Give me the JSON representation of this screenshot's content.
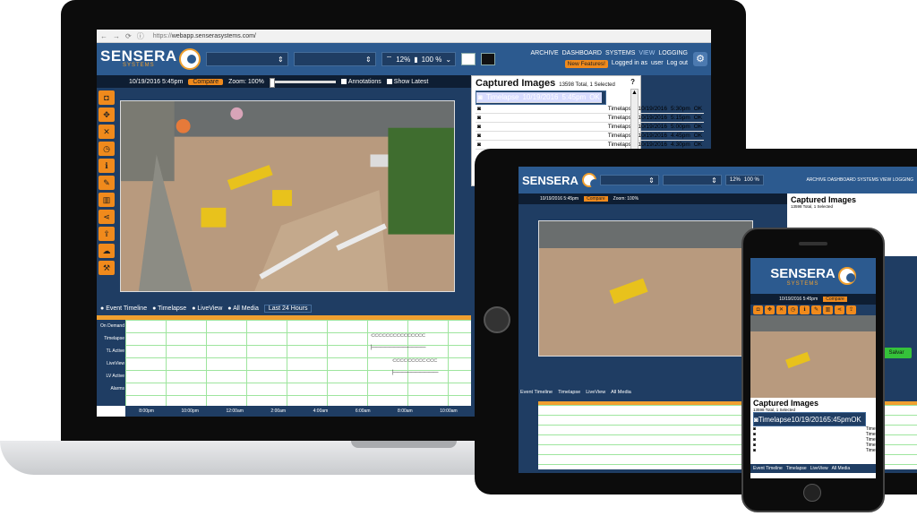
{
  "browser": {
    "url_scheme": "https://",
    "url_host": "webapp.senserasystems.com/"
  },
  "brand": {
    "name": "SENSERA",
    "sub": "SYSTEMS"
  },
  "header": {
    "wifi": "12%",
    "battery": "100 %",
    "menu": [
      "ARCHIVE",
      "DASHBOARD",
      "SYSTEMS",
      "VIEW",
      "LOGGING"
    ],
    "new_features": "New Features!",
    "logged_in": "Logged in as",
    "user": "user",
    "logout": "Log out"
  },
  "toolbar": {
    "datetime": "10/19/2016  5:45pm",
    "compare": "Compare",
    "zoom": "Zoom: 100%",
    "annotations": "Annotations",
    "show_latest": "Show Latest"
  },
  "captured": {
    "title": "Captured Images",
    "summary": "13598 Total, 1 Selected",
    "help": "?",
    "rows": [
      {
        "type": "Timelapse",
        "date": "10/19/2016",
        "time": "5:45pm",
        "status": "OK"
      },
      {
        "type": "Timelapse",
        "date": "10/19/2016",
        "time": "5:30pm",
        "status": "OK"
      },
      {
        "type": "Timelapse",
        "date": "10/19/2016",
        "time": "5:15pm",
        "status": "OK"
      },
      {
        "type": "Timelapse",
        "date": "10/19/2016",
        "time": "5:00pm",
        "status": "OK"
      },
      {
        "type": "Timelapse",
        "date": "10/19/2016",
        "time": "4:45pm",
        "status": "OK"
      },
      {
        "type": "Timelapse",
        "date": "10/19/2016",
        "time": "4:30pm",
        "status": "OK"
      }
    ]
  },
  "timeline": {
    "tabs": [
      "Event Timeline",
      "Timelapse",
      "LiveView",
      "All Media"
    ],
    "range": "Last 24 Hours",
    "rows": [
      "On Demand",
      "Timelapse",
      "TL Active",
      "LiveView",
      "LV Active",
      "Alarms"
    ],
    "times": [
      "8:00pm",
      "10:00pm",
      "12:00am",
      "2:00am",
      "4:00am",
      "6:00am",
      "8:00am",
      "10:00am"
    ]
  },
  "tablet": {
    "save": "Salvar"
  },
  "colors": {
    "accent": "#f08a1c",
    "header": "#2c5a8f",
    "dark": "#1f3d63",
    "selected": "#d8dcff"
  }
}
